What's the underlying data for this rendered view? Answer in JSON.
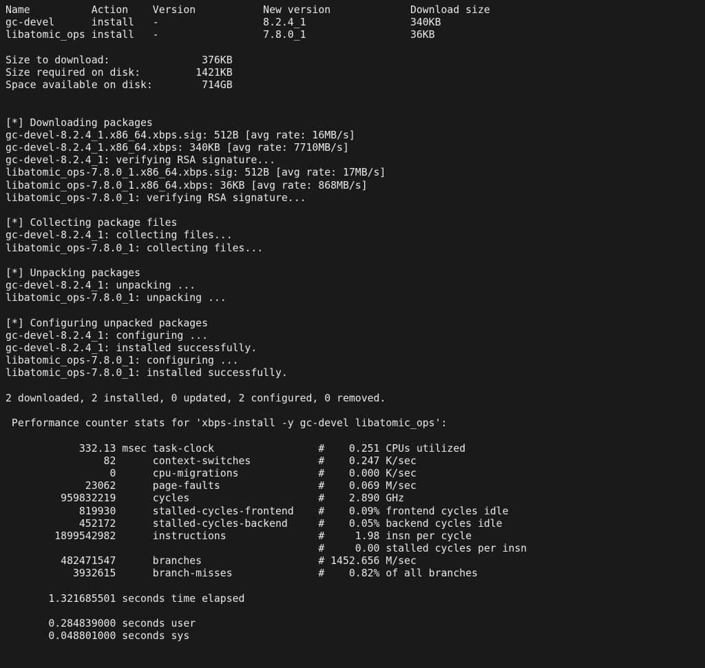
{
  "header": {
    "cols": [
      "Name",
      "Action",
      "Version",
      "New version",
      "Download size"
    ]
  },
  "packages": [
    {
      "name": "gc-devel",
      "action": "install",
      "version": "-",
      "new_version": "8.2.4_1",
      "size": "340KB"
    },
    {
      "name": "libatomic_ops",
      "action": "install",
      "version": "-",
      "new_version": "7.8.0_1",
      "size": "36KB"
    }
  ],
  "sizes": {
    "download_label": "Size to download:",
    "download": "376KB",
    "disk_label": "Size required on disk:",
    "disk": "1421KB",
    "space_label": "Space available on disk:",
    "space": "714GB"
  },
  "sections": {
    "downloading": "[*] Downloading packages",
    "collecting": "[*] Collecting package files",
    "unpacking": "[*] Unpacking packages",
    "configuring": "[*] Configuring unpacked packages"
  },
  "download_lines": [
    "gc-devel-8.2.4_1.x86_64.xbps.sig: 512B [avg rate: 16MB/s]",
    "gc-devel-8.2.4_1.x86_64.xbps: 340KB [avg rate: 7710MB/s]",
    "gc-devel-8.2.4_1: verifying RSA signature...",
    "libatomic_ops-7.8.0_1.x86_64.xbps.sig: 512B [avg rate: 17MB/s]",
    "libatomic_ops-7.8.0_1.x86_64.xbps: 36KB [avg rate: 868MB/s]",
    "libatomic_ops-7.8.0_1: verifying RSA signature..."
  ],
  "collect_lines": [
    "gc-devel-8.2.4_1: collecting files...",
    "libatomic_ops-7.8.0_1: collecting files..."
  ],
  "unpack_lines": [
    "gc-devel-8.2.4_1: unpacking ...",
    "libatomic_ops-7.8.0_1: unpacking ..."
  ],
  "configure_lines": [
    "gc-devel-8.2.4_1: configuring ...",
    "gc-devel-8.2.4_1: installed successfully.",
    "libatomic_ops-7.8.0_1: configuring ...",
    "libatomic_ops-7.8.0_1: installed successfully."
  ],
  "summary": "2 downloaded, 2 installed, 0 updated, 2 configured, 0 removed.",
  "perf_header": " Performance counter stats for 'xbps-install -y gc-devel libatomic_ops':",
  "perf": [
    {
      "v": "332.13",
      "u": "msec",
      "m": "task-clock",
      "r": "0.251",
      "d": "CPUs utilized"
    },
    {
      "v": "82",
      "u": "",
      "m": "context-switches",
      "r": "0.247",
      "d": "K/sec"
    },
    {
      "v": "0",
      "u": "",
      "m": "cpu-migrations",
      "r": "0.000",
      "d": "K/sec"
    },
    {
      "v": "23062",
      "u": "",
      "m": "page-faults",
      "r": "0.069",
      "d": "M/sec"
    },
    {
      "v": "959832219",
      "u": "",
      "m": "cycles",
      "r": "2.890",
      "d": "GHz"
    },
    {
      "v": "819930",
      "u": "",
      "m": "stalled-cycles-frontend",
      "r": "0.09%",
      "d": "frontend cycles idle"
    },
    {
      "v": "452172",
      "u": "",
      "m": "stalled-cycles-backend",
      "r": "0.05%",
      "d": "backend cycles idle"
    },
    {
      "v": "1899542982",
      "u": "",
      "m": "instructions",
      "r": "1.98",
      "d": "insn per cycle"
    },
    {
      "v": "",
      "u": "",
      "m": "",
      "r": "0.00",
      "d": "stalled cycles per insn"
    },
    {
      "v": "482471547",
      "u": "",
      "m": "branches",
      "r": "1452.656",
      "d": "M/sec"
    },
    {
      "v": "3932615",
      "u": "",
      "m": "branch-misses",
      "r": "0.82%",
      "d": "of all branches"
    }
  ],
  "timing": {
    "elapsed": "1.321685501",
    "elapsed_label": "seconds time elapsed",
    "user": "0.284839000",
    "user_label": "seconds user",
    "sys": "0.048801000",
    "sys_label": "seconds sys"
  }
}
